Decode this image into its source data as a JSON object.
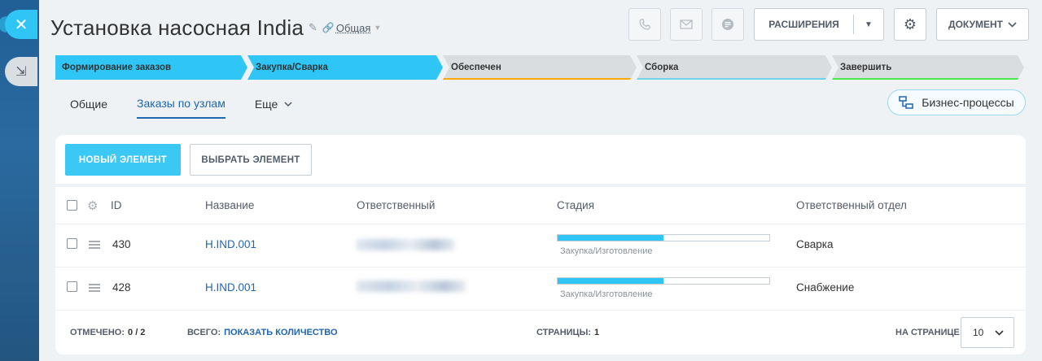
{
  "header": {
    "title": "Установка насосная India",
    "type_label": "Общая",
    "extensions_label": "РАСШИРЕНИЯ",
    "document_label": "ДОКУМЕНТ"
  },
  "icons": {
    "close": "close-icon",
    "collapse": "collapse-icon",
    "phone": "phone-icon",
    "mail": "mail-icon",
    "chat": "chat-icon",
    "gear": "gear-icon"
  },
  "stages": [
    {
      "label": "Формирование заказов",
      "state": "active",
      "color": "#2fc6f6"
    },
    {
      "label": "Закупка/Сварка",
      "state": "active",
      "color": "#2fc6f6"
    },
    {
      "label": "Обеспечен",
      "state": "idle",
      "color": "#ffa900"
    },
    {
      "label": "Сборка",
      "state": "idle",
      "color": "#6ed3eb"
    },
    {
      "label": "Завершить",
      "state": "idle",
      "color": "#47e84b"
    }
  ],
  "tabs": [
    {
      "label": "Общие"
    },
    {
      "label": "Заказы по узлам"
    },
    {
      "label": "Еще"
    }
  ],
  "business_processes_label": "Бизнес-процессы",
  "actions": {
    "new_label": "НОВЫЙ ЭЛЕМЕНТ",
    "pick_label": "ВЫБРАТЬ ЭЛЕМЕНТ"
  },
  "grid": {
    "columns": {
      "id": "ID",
      "name": "Название",
      "responsible": "Ответственный",
      "stage": "Стадия",
      "department": "Ответственный отдел"
    },
    "rows": [
      {
        "id": "430",
        "name": "H.IND.001",
        "stage_label": "Закупка/Изготовление",
        "stage_progress": 0.5,
        "department": "Сварка"
      },
      {
        "id": "428",
        "name": "H.IND.001",
        "stage_label": "Закупка/Изготовление",
        "stage_progress": 0.5,
        "department": "Снабжение"
      }
    ]
  },
  "footer": {
    "selected_label": "ОТМЕЧЕНО:",
    "selected_value": "0 / 2",
    "total_label": "ВСЕГО:",
    "total_link": "ПОКАЗАТЬ КОЛИЧЕСТВО",
    "pages_label": "СТРАНИЦЫ:",
    "pages_value": "1",
    "per_page_label": "НА СТРАНИЦЕ:",
    "per_page_value": "10"
  }
}
